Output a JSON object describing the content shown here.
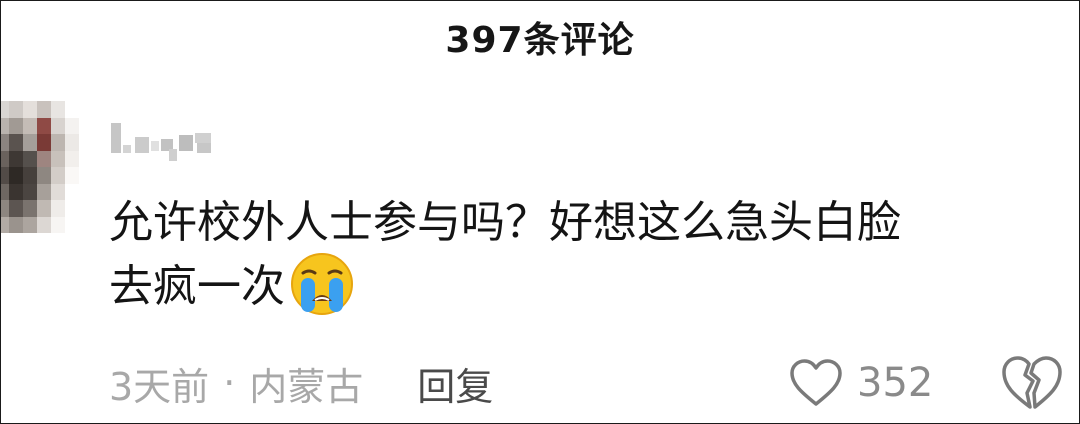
{
  "header": {
    "title": "397条评论"
  },
  "comment": {
    "username": "",
    "text_line1": "允许校外人士参与吗？好想这么急头白脸",
    "text_line2": "去疯一次",
    "emoji": "loudly-crying-face-emoji",
    "time_ago": "3天前",
    "separator": "·",
    "location": "内蒙古",
    "reply_label": "回复",
    "like_count": "352",
    "like_icon": "heart-outline-icon",
    "dislike_icon": "broken-heart-icon"
  },
  "colors": {
    "text_primary": "#141414",
    "text_meta": "#a8a8a8",
    "reply_text": "#4a4a4a",
    "icon_gray": "#8a8a8a",
    "emoji_yellow": "#f5c518",
    "emoji_tears": "#3ba0f0"
  }
}
